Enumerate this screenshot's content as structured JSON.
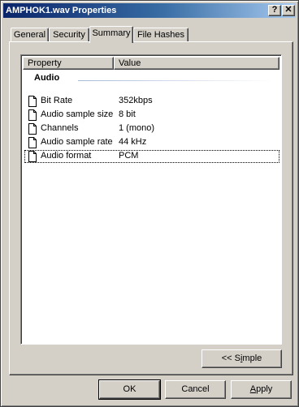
{
  "window": {
    "title": "AMPHOK1.wav Properties",
    "help_glyph": "?",
    "close_glyph": "✕"
  },
  "tabs": [
    {
      "label": "General"
    },
    {
      "label": "Security"
    },
    {
      "label": "Summary",
      "selected": true
    },
    {
      "label": "File Hashes"
    }
  ],
  "list": {
    "columns": [
      "Property",
      "Value"
    ],
    "group": "Audio",
    "rows": [
      {
        "property": "Bit Rate",
        "value": "352kbps"
      },
      {
        "property": "Audio sample size",
        "value": "8 bit"
      },
      {
        "property": "Channels",
        "value": "1 (mono)"
      },
      {
        "property": "Audio sample rate",
        "value": "44 kHz"
      },
      {
        "property": "Audio format",
        "value": "PCM",
        "focused": true
      }
    ]
  },
  "buttons": {
    "simple": {
      "prefix": "<< S",
      "accel": "i",
      "suffix": "mple"
    },
    "ok": "OK",
    "cancel": "Cancel",
    "apply": {
      "accel": "A",
      "suffix": "pply"
    }
  },
  "colors": {
    "title_gradient_start": "#0a246a",
    "title_gradient_end": "#a6caf0",
    "face": "#d4d0c8"
  }
}
